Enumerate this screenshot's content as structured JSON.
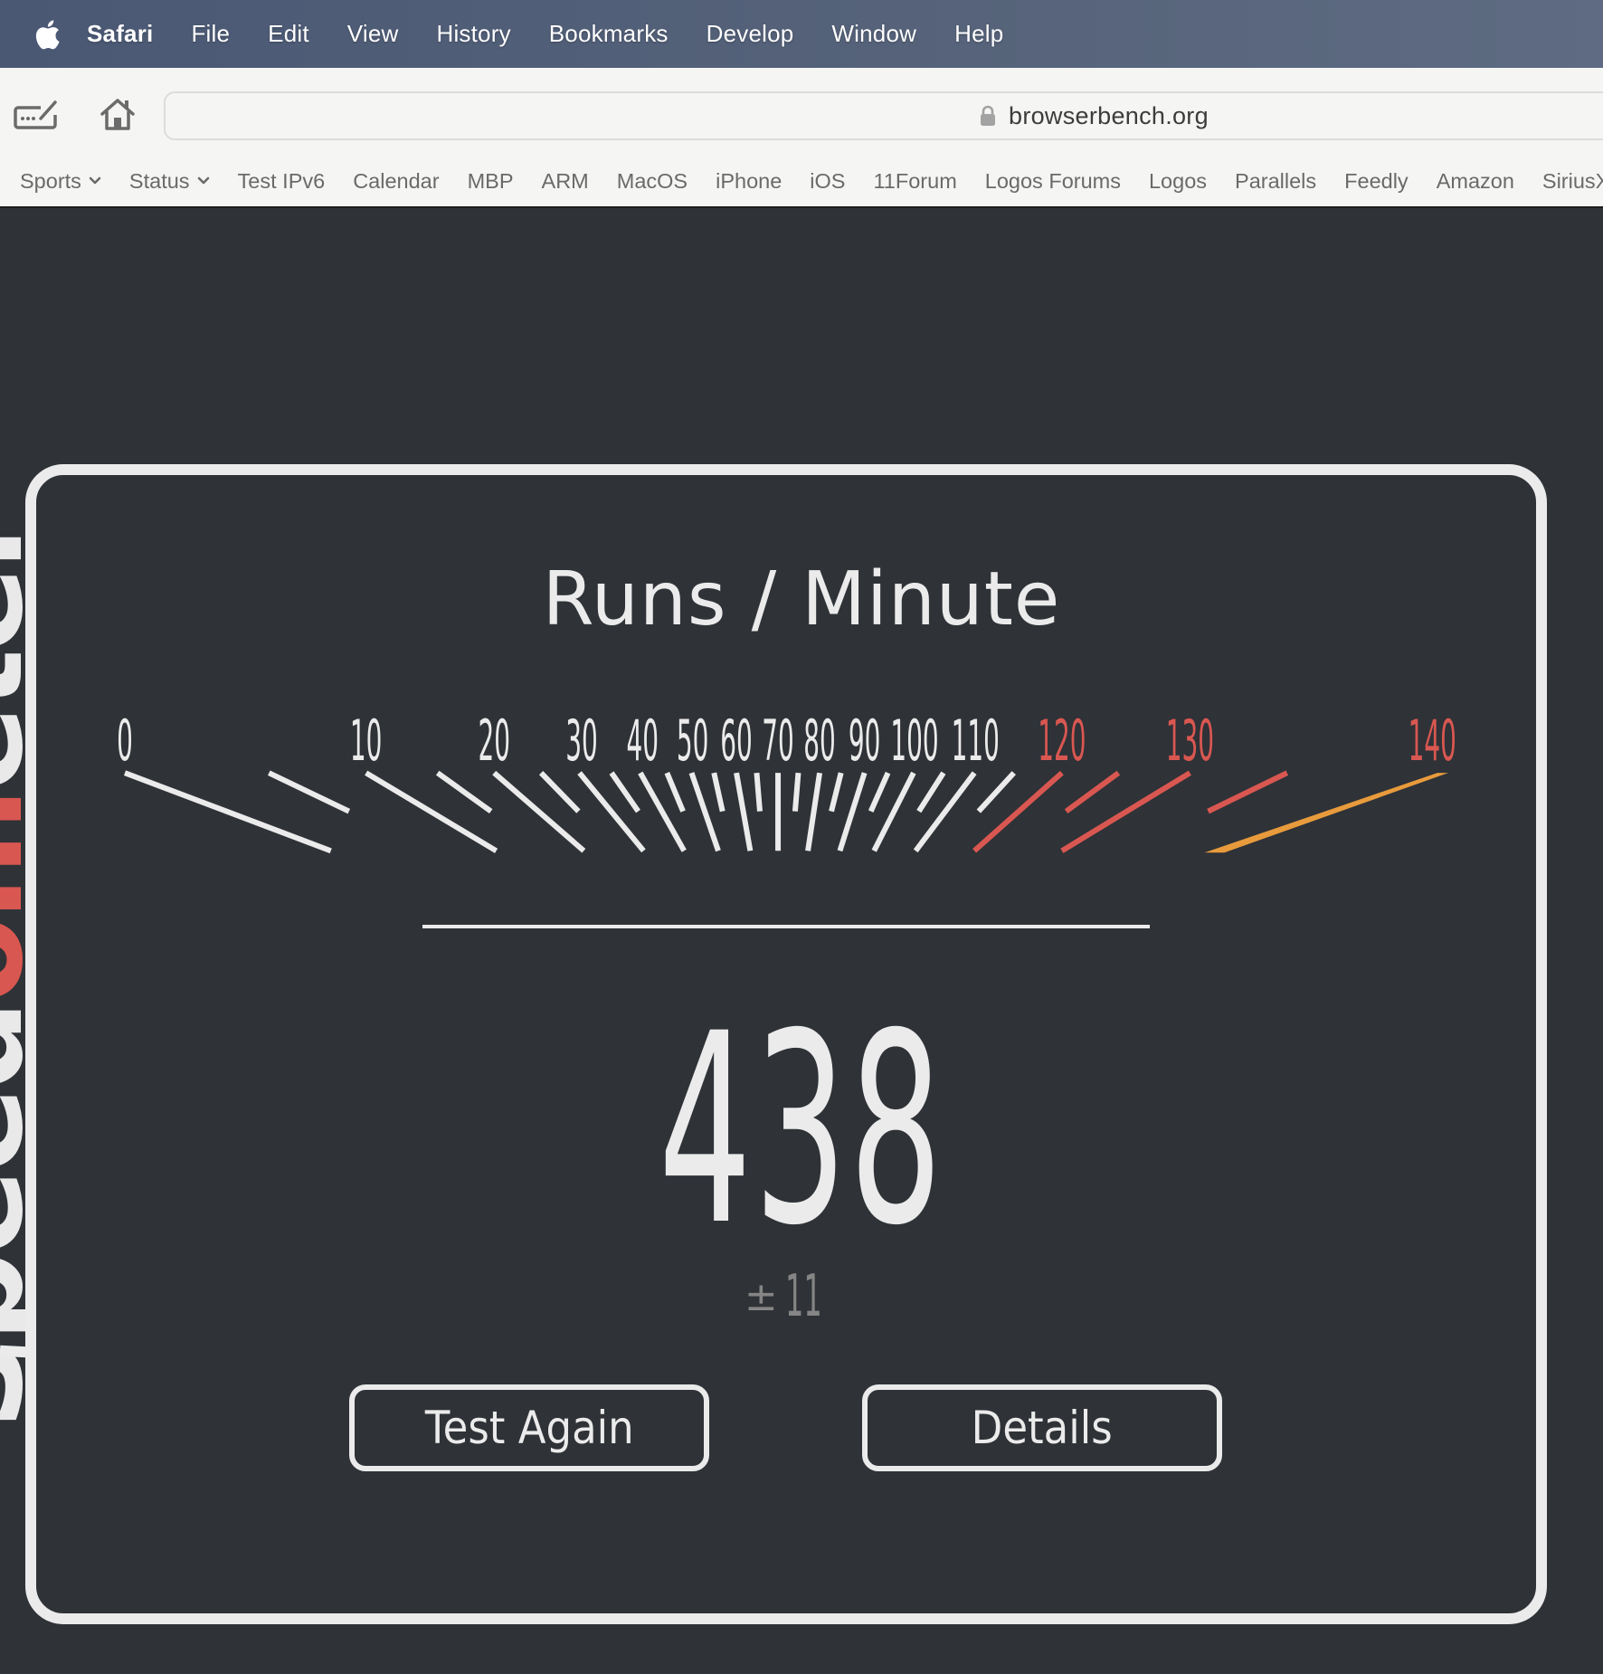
{
  "menubar": {
    "app_name": "Safari",
    "items": [
      "File",
      "Edit",
      "View",
      "History",
      "Bookmarks",
      "Develop",
      "Window",
      "Help"
    ]
  },
  "toolbar": {
    "address": "browserbench.org",
    "icons": [
      "sidebar-compose-icon",
      "home-icon",
      "lock-icon"
    ]
  },
  "bookmarks": [
    {
      "label": "Sports",
      "dropdown": true
    },
    {
      "label": "Status",
      "dropdown": true
    },
    {
      "label": "Test IPv6",
      "dropdown": false
    },
    {
      "label": "Calendar",
      "dropdown": false
    },
    {
      "label": "MBP",
      "dropdown": false
    },
    {
      "label": "ARM",
      "dropdown": false
    },
    {
      "label": "MacOS",
      "dropdown": false
    },
    {
      "label": "iPhone",
      "dropdown": false
    },
    {
      "label": "iOS",
      "dropdown": false
    },
    {
      "label": "11Forum",
      "dropdown": false
    },
    {
      "label": "Logos Forums",
      "dropdown": false
    },
    {
      "label": "Logos",
      "dropdown": false
    },
    {
      "label": "Parallels",
      "dropdown": false
    },
    {
      "label": "Feedly",
      "dropdown": false
    },
    {
      "label": "Amazon",
      "dropdown": false
    },
    {
      "label": "SiriusXM",
      "dropdown": false
    }
  ],
  "brand": {
    "prefix": "Speed",
    "accent": "om",
    "suffix": "eter"
  },
  "gauge": {
    "title": "Runs / Minute",
    "labels": [
      "0",
      "10",
      "20",
      "30",
      "40",
      "50",
      "60",
      "70",
      "80",
      "90",
      "100",
      "110",
      "120",
      "130",
      "140"
    ],
    "red_from": 120,
    "orange_value": 140,
    "colors": {
      "normal": "#ebebeb",
      "red": "#d95751",
      "orange": "#e89b3c"
    }
  },
  "result": {
    "score": "438",
    "plus_minus": "±",
    "error": "11"
  },
  "buttons": {
    "test_again": "Test Again",
    "details": "Details"
  }
}
